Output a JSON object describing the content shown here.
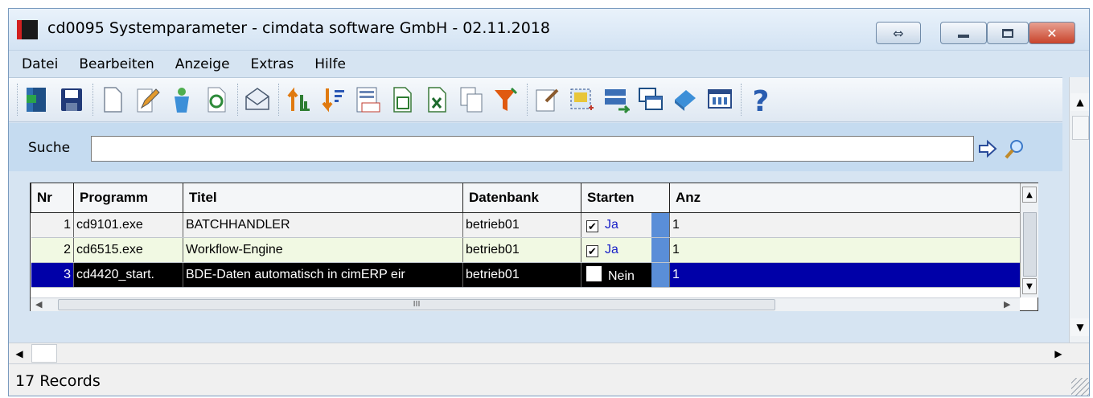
{
  "window": {
    "title": "cd0095 Systemparameter - cimdata software GmbH - 02.11.2018",
    "controls": {
      "restore_arrows": "⇔",
      "minimize": "▬",
      "maximize": "▢",
      "close": "✕"
    }
  },
  "menu": {
    "items": [
      "Datei",
      "Bearbeiten",
      "Anzeige",
      "Extras",
      "Hilfe"
    ]
  },
  "toolbar": {
    "icons": [
      "exit-icon",
      "save-icon",
      "new-document-icon",
      "edit-icon",
      "recycle-icon",
      "refresh-icon",
      "envelope-icon",
      "sort-ascending-icon",
      "sort-descending-icon",
      "numbering-icon",
      "export-icon",
      "excel-icon",
      "copy-icon",
      "filter-icon",
      "properties-icon",
      "select-area-icon",
      "transfer-icon",
      "windows-icon",
      "book-icon",
      "columns-icon",
      "help-icon"
    ]
  },
  "search": {
    "label": "Suche",
    "value": "",
    "go_icon": "arrow-right-icon",
    "find_icon": "magnifier-icon"
  },
  "grid": {
    "columns": [
      "Nr",
      "Programm",
      "Titel",
      "Datenbank",
      "Starten",
      "Anz"
    ],
    "rows": [
      {
        "nr": "1",
        "programm": "cd9101.exe",
        "titel": "BATCHHANDLER",
        "datenbank": "betrieb01",
        "starten_checked": true,
        "starten": "Ja",
        "anz": "1"
      },
      {
        "nr": "2",
        "programm": "cd6515.exe",
        "titel": "Workflow-Engine",
        "datenbank": "betrieb01",
        "starten_checked": true,
        "starten": "Ja",
        "anz": "1"
      },
      {
        "nr": "3",
        "programm": "cd4420_start.",
        "titel": "BDE-Daten automatisch in cimERP eir",
        "datenbank": "betrieb01",
        "starten_checked": false,
        "starten": "Nein",
        "anz": "1"
      }
    ],
    "hscroll_grip": "III"
  },
  "status": {
    "records": "17 Records"
  },
  "colors": {
    "selected_row": "#0000a8",
    "alt_row": "#f1f9e3",
    "window_bg": "#d6e4f2",
    "title_accent": "#d22020"
  }
}
